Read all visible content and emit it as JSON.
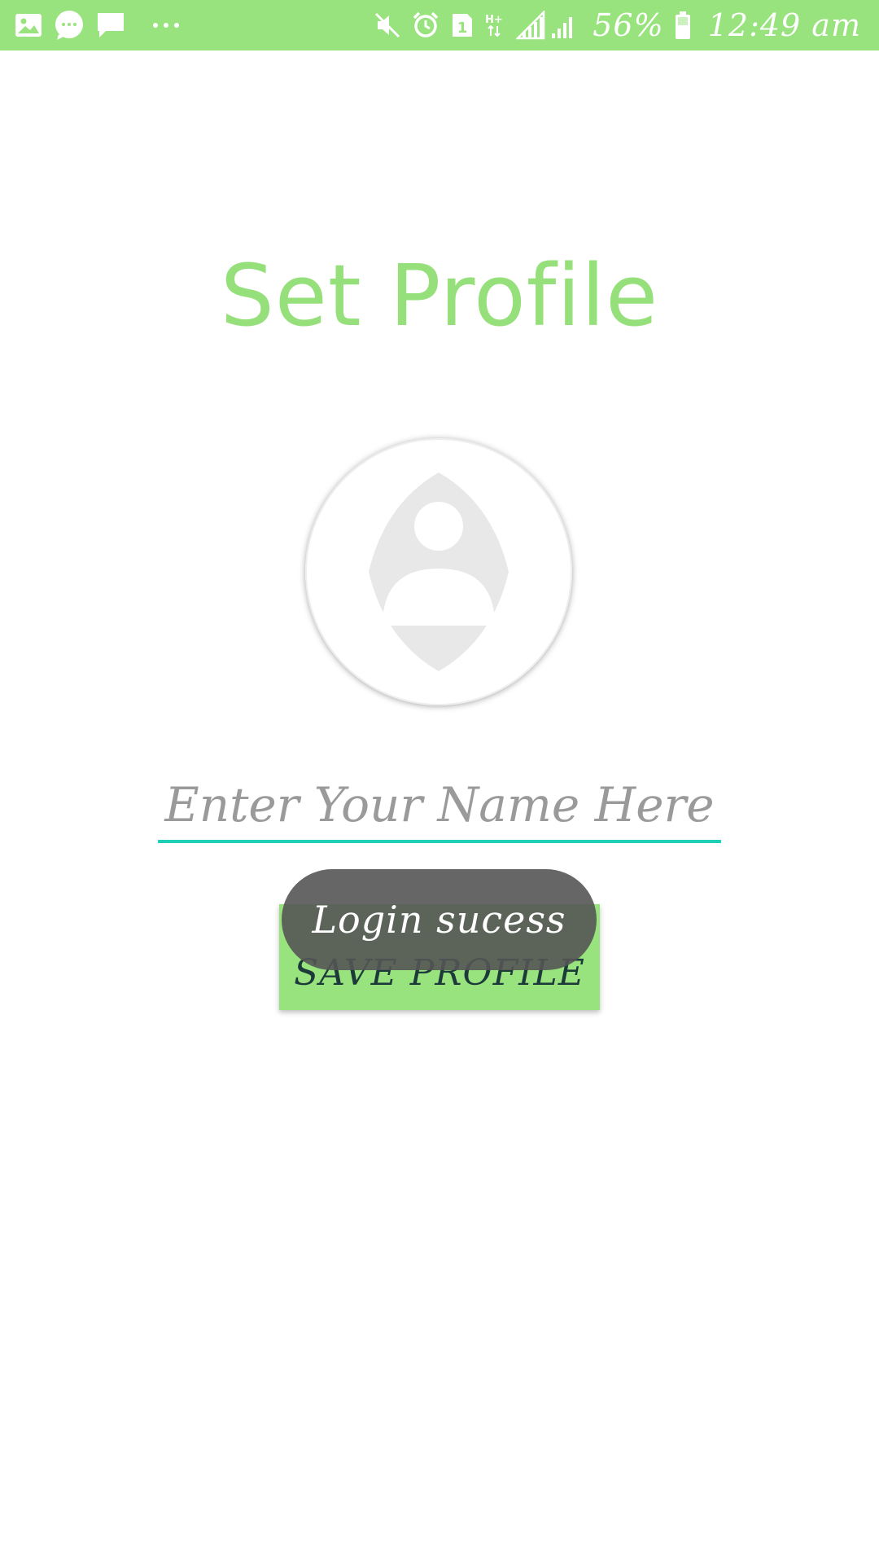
{
  "status_bar": {
    "left_icons": [
      "gallery-icon",
      "chat-bubble-icon",
      "message-icon",
      "more-dots-icon"
    ],
    "right_icons": [
      "mute-icon",
      "alarm-icon",
      "sim-1-icon",
      "hplus-data-icon",
      "signal-1-icon",
      "signal-2-icon",
      "battery-icon"
    ],
    "battery_percent": "56%",
    "time": "12:49 am",
    "background_color": "#98e37d"
  },
  "page": {
    "title": "Set Profile",
    "title_color": "#95e07a"
  },
  "avatar": {
    "icon": "default-profile-icon"
  },
  "name_field": {
    "value": "",
    "placeholder": "Enter Your Name Here",
    "underline_color": "#1fcfb7"
  },
  "save_button": {
    "label": "SAVE PROFILE",
    "background_color": "#98e37d"
  },
  "toast": {
    "message": "Login sucess"
  }
}
